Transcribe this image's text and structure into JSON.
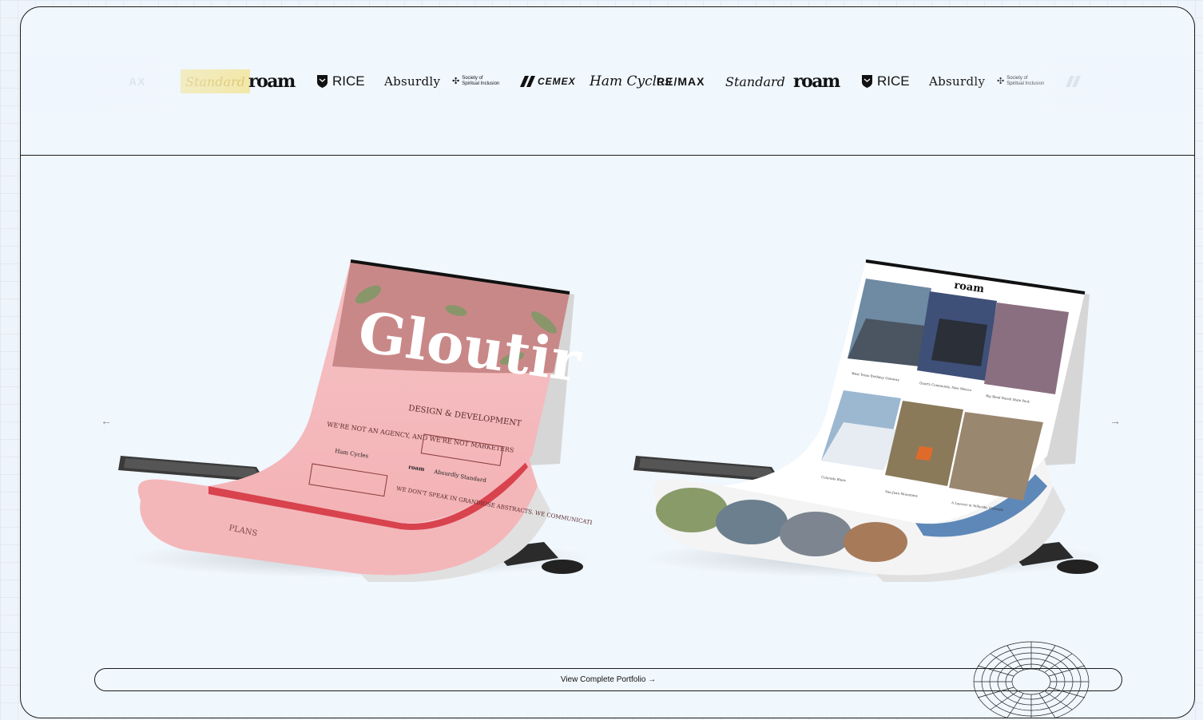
{
  "logos": [
    {
      "name": "remax-partial",
      "text": "AX"
    },
    {
      "name": "standard",
      "text": "Standard"
    },
    {
      "name": "roam",
      "text": "roam"
    },
    {
      "name": "rice",
      "text": "RICE"
    },
    {
      "name": "absurdly",
      "text": "Absurdly"
    },
    {
      "name": "society",
      "line1": "Society of",
      "line2": "Spiritual Inclusion"
    },
    {
      "name": "cemex",
      "text": "CEMEX"
    },
    {
      "name": "ham-cycles",
      "text": "Ham Cycles"
    },
    {
      "name": "remax",
      "text": "RE/MAX"
    },
    {
      "name": "standard",
      "text": "Standard"
    },
    {
      "name": "roam",
      "text": "roam"
    },
    {
      "name": "rice",
      "text": "RICE"
    },
    {
      "name": "absurdly",
      "text": "Absurdly"
    },
    {
      "name": "society",
      "line1": "Society of",
      "line2": "Spiritual Inclusion"
    }
  ],
  "slides": [
    {
      "title": "Gloutir",
      "heading": "DESIGN & DEVELOPMENT",
      "tagline": "WE'RE NOT AN AGENCY, AND WE'RE NOT MARKETERS",
      "tagline2": "WE DON'T SPEAK IN GRANDIOSE ABSTRACTS. WE COMMUNICATE. WE ARTICULATE. WE CREATE.",
      "footer": "PLANS",
      "logos": [
        "Ham Cycles",
        "roam",
        "Absurdly",
        "Standard"
      ]
    },
    {
      "brand": "roam",
      "captions": [
        "West Texas Birthday Getaway",
        "Quartz Community, New Mexico",
        "Big Bend Ranch State Park",
        "Colorado Blues",
        "San Juan Mountains",
        "A Layover in Telluride, Colorado"
      ]
    }
  ],
  "nav": {
    "prev": "←",
    "next": "→"
  },
  "cta": {
    "label": "View Complete Portfolio →"
  },
  "colors": {
    "accent_pink": "#f4b5b8",
    "accent_red": "#d8434e",
    "frame_border": "#1b1b1b"
  }
}
